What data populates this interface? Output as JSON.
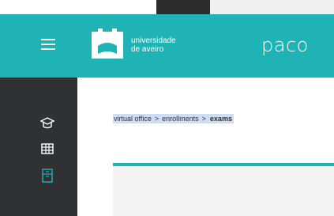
{
  "header": {
    "logo_line1": "universidade",
    "logo_line2": "de aveiro",
    "app_name": "paco"
  },
  "breadcrumb": {
    "items": [
      "virtual office",
      "enrollments"
    ],
    "separator": ">",
    "current": "exams"
  },
  "sidebar": {
    "icons": [
      "graduation-cap-icon",
      "grid-icon",
      "cabinet-icon"
    ]
  },
  "colors": {
    "accent": "#1fb3b5",
    "sidebar": "#2f3132",
    "selection": "#cfdcf5"
  }
}
